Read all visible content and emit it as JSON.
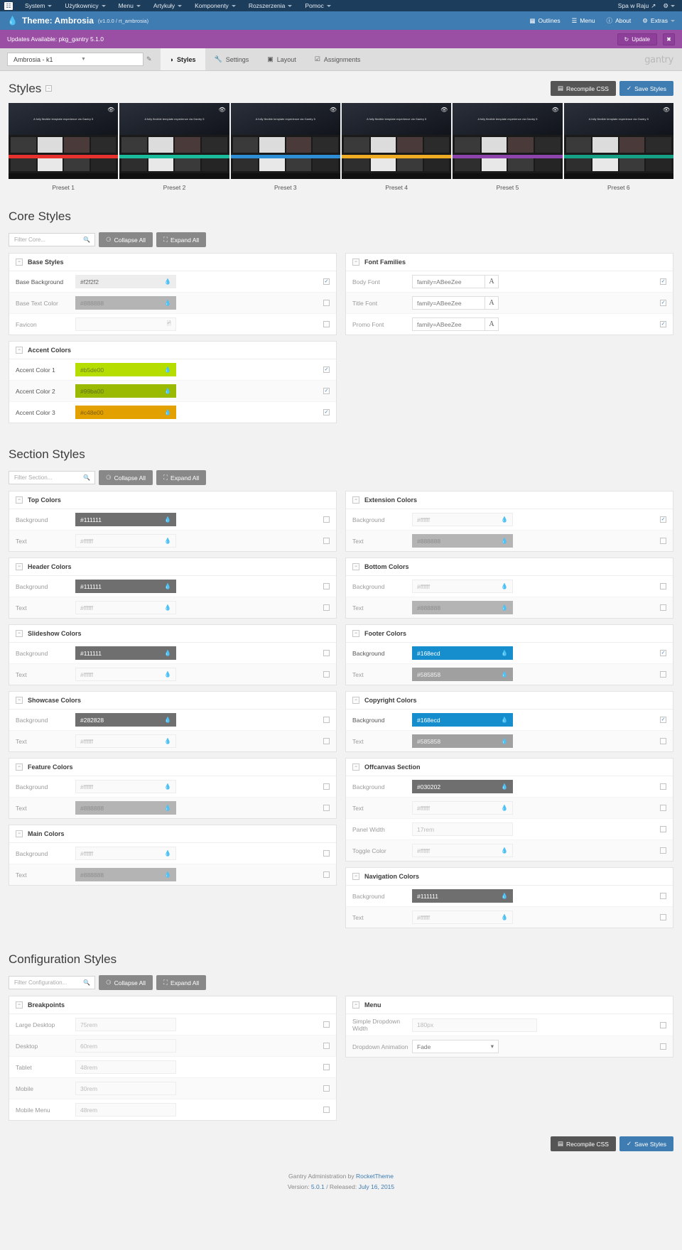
{
  "joomla_bar": {
    "logo_icon": "joomla-logo-icon",
    "menu": [
      "System",
      "Użytkownicy",
      "Menu",
      "Artykuły",
      "Komponenty",
      "Rozszerzenia",
      "Pomoc"
    ],
    "site_name": "Spa w Raju",
    "gear_icon": "gear-icon"
  },
  "gantry_header": {
    "drop_icon": "droplet-icon",
    "title": "Theme: Ambrosia",
    "version": "(v1.0.0 / rt_ambrosia)",
    "actions": [
      {
        "label": "Outlines",
        "icon": "grid-icon"
      },
      {
        "label": "Menu",
        "icon": "list-icon"
      },
      {
        "label": "About",
        "icon": "question-icon"
      },
      {
        "label": "Extras",
        "icon": "gear-icon"
      }
    ]
  },
  "update_bar": {
    "message": "Updates Available: pkg_gantry 5.1.0",
    "update_label": "Update",
    "update_icon": "refresh-icon",
    "close_icon": "close-icon"
  },
  "tabbar": {
    "outline_value": "Ambrosia - k1",
    "pencil_icon": "pencil-icon",
    "tabs": [
      {
        "label": "Styles",
        "icon": "contrast-icon",
        "active": true
      },
      {
        "label": "Settings",
        "icon": "wrench-icon",
        "active": false
      },
      {
        "label": "Layout",
        "icon": "layout-icon",
        "active": false
      },
      {
        "label": "Assignments",
        "icon": "check-square-icon",
        "active": false
      }
    ],
    "brand": "gantry"
  },
  "styles_header": {
    "title": "Styles",
    "recompile_label": "Recompile CSS",
    "recompile_icon": "css-icon",
    "save_label": "Save Styles",
    "save_icon": "check-icon"
  },
  "presets": [
    {
      "label": "Preset 1",
      "accent": "#e8322e",
      "eye_icon": "eye-icon"
    },
    {
      "label": "Preset 2",
      "accent": "#1abc9c",
      "eye_icon": "eye-icon"
    },
    {
      "label": "Preset 3",
      "accent": "#2f8fd6",
      "eye_icon": "eye-icon"
    },
    {
      "label": "Preset 4",
      "accent": "#f0ad24",
      "eye_icon": "eye-icon"
    },
    {
      "label": "Preset 5",
      "accent": "#8e44ad",
      "eye_icon": "eye-icon"
    },
    {
      "label": "Preset 6",
      "accent": "#16a085",
      "eye_icon": "eye-icon"
    }
  ],
  "preset_thumb_text": "A fully flexible template experience via Gantry 5",
  "core": {
    "title": "Core Styles",
    "filter_placeholder": "Filter Core...",
    "collapse_label": "Collapse All",
    "expand_label": "Expand All",
    "panels_left": [
      {
        "title": "Base Styles",
        "fields": [
          {
            "label": "Base Background",
            "value": "#f2f2f2",
            "type": "color",
            "bg": "#ededed",
            "fg": "#666",
            "disabled": false,
            "override": true
          },
          {
            "label": "Base Text Color",
            "value": "#888888",
            "type": "color",
            "bg": "#b4b4b4",
            "fg": "#8d8d8d",
            "disabled": true,
            "override": false
          },
          {
            "label": "Favicon",
            "value": "",
            "type": "file",
            "disabled": true,
            "override": false
          }
        ]
      },
      {
        "title": "Accent Colors",
        "fields": [
          {
            "label": "Accent Color 1",
            "value": "#b5de00",
            "type": "color",
            "bg": "#b5de00",
            "fg": "#6b7d22",
            "disabled": false,
            "override": true
          },
          {
            "label": "Accent Color 2",
            "value": "#99ba00",
            "type": "color",
            "bg": "#99ba00",
            "fg": "#5d7017",
            "disabled": false,
            "override": true
          },
          {
            "label": "Accent Color 3",
            "value": "#c48e00",
            "type": "color",
            "bg": "#e2a100",
            "fg": "#7d5d0b",
            "disabled": false,
            "override": true
          }
        ]
      }
    ],
    "panels_right": [
      {
        "title": "Font Families",
        "fields": [
          {
            "label": "Body Font",
            "value": "family=ABeeZee",
            "type": "font",
            "btn": "A",
            "override": true
          },
          {
            "label": "Title Font",
            "value": "family=ABeeZee",
            "type": "font",
            "btn": "A",
            "override": true
          },
          {
            "label": "Promo Font",
            "value": "family=ABeeZee",
            "type": "font",
            "btn": "A",
            "override": true
          }
        ]
      }
    ]
  },
  "section": {
    "title": "Section Styles",
    "filter_placeholder": "Filter Section...",
    "collapse_label": "Collapse All",
    "expand_label": "Expand All",
    "panels_left": [
      {
        "title": "Top Colors",
        "fields": [
          {
            "label": "Background",
            "value": "#111111",
            "type": "color",
            "bg": "#6f6f6f",
            "fg": "#ffffff",
            "disabled": true,
            "override": false
          },
          {
            "label": "Text",
            "value": "#ffffff",
            "type": "color",
            "bg": "#fafafa",
            "fg": "#b9b9b9",
            "disabled": true,
            "override": false
          }
        ]
      },
      {
        "title": "Header Colors",
        "fields": [
          {
            "label": "Background",
            "value": "#111111",
            "type": "color",
            "bg": "#6f6f6f",
            "fg": "#ffffff",
            "disabled": true,
            "override": false
          },
          {
            "label": "Text",
            "value": "#ffffff",
            "type": "color",
            "bg": "#fafafa",
            "fg": "#b9b9b9",
            "disabled": true,
            "override": false
          }
        ]
      },
      {
        "title": "Slideshow Colors",
        "fields": [
          {
            "label": "Background",
            "value": "#111111",
            "type": "color",
            "bg": "#6f6f6f",
            "fg": "#ffffff",
            "disabled": true,
            "override": false
          },
          {
            "label": "Text",
            "value": "#ffffff",
            "type": "color",
            "bg": "#fafafa",
            "fg": "#b9b9b9",
            "disabled": true,
            "override": false
          }
        ]
      },
      {
        "title": "Showcase Colors",
        "fields": [
          {
            "label": "Background",
            "value": "#282828",
            "type": "color",
            "bg": "#6f6f6f",
            "fg": "#ffffff",
            "disabled": true,
            "override": false
          },
          {
            "label": "Text",
            "value": "#ffffff",
            "type": "color",
            "bg": "#fafafa",
            "fg": "#b9b9b9",
            "disabled": true,
            "override": false
          }
        ]
      },
      {
        "title": "Feature Colors",
        "fields": [
          {
            "label": "Background",
            "value": "#ffffff",
            "type": "color",
            "bg": "#fafafa",
            "fg": "#b9b9b9",
            "disabled": true,
            "override": false
          },
          {
            "label": "Text",
            "value": "#888888",
            "type": "color",
            "bg": "#b4b4b4",
            "fg": "#8d8d8d",
            "disabled": true,
            "override": false
          }
        ]
      },
      {
        "title": "Main Colors",
        "fields": [
          {
            "label": "Background",
            "value": "#ffffff",
            "type": "color",
            "bg": "#fafafa",
            "fg": "#b9b9b9",
            "disabled": true,
            "override": false
          },
          {
            "label": "Text",
            "value": "#888888",
            "type": "color",
            "bg": "#b4b4b4",
            "fg": "#8d8d8d",
            "disabled": true,
            "override": false
          }
        ]
      }
    ],
    "panels_right": [
      {
        "title": "Extension Colors",
        "fields": [
          {
            "label": "Background",
            "value": "#ffffff",
            "type": "color",
            "bg": "#fcfcfc",
            "fg": "#b9b9b9",
            "disabled": true,
            "override": true
          },
          {
            "label": "Text",
            "value": "#888888",
            "type": "color",
            "bg": "#b4b4b4",
            "fg": "#8d8d8d",
            "disabled": true,
            "override": false
          }
        ]
      },
      {
        "title": "Bottom Colors",
        "fields": [
          {
            "label": "Background",
            "value": "#ffffff",
            "type": "color",
            "bg": "#fafafa",
            "fg": "#b9b9b9",
            "disabled": true,
            "override": false
          },
          {
            "label": "Text",
            "value": "#888888",
            "type": "color",
            "bg": "#b4b4b4",
            "fg": "#8d8d8d",
            "disabled": true,
            "override": false
          }
        ]
      },
      {
        "title": "Footer Colors",
        "fields": [
          {
            "label": "Background",
            "value": "#168ecd",
            "type": "color",
            "bg": "#168ecd",
            "fg": "#ffffff",
            "disabled": false,
            "override": true
          },
          {
            "label": "Text",
            "value": "#585858",
            "type": "color",
            "bg": "#a0a0a0",
            "fg": "#efefef",
            "disabled": true,
            "override": false
          }
        ]
      },
      {
        "title": "Copyright Colors",
        "fields": [
          {
            "label": "Background",
            "value": "#168ecd",
            "type": "color",
            "bg": "#168ecd",
            "fg": "#ffffff",
            "disabled": false,
            "override": true
          },
          {
            "label": "Text",
            "value": "#585858",
            "type": "color",
            "bg": "#a0a0a0",
            "fg": "#efefef",
            "disabled": true,
            "override": false
          }
        ]
      },
      {
        "title": "Offcanvas Section",
        "fields": [
          {
            "label": "Background",
            "value": "#030202",
            "type": "color",
            "bg": "#6f6f6f",
            "fg": "#ffffff",
            "disabled": true,
            "override": false
          },
          {
            "label": "Text",
            "value": "#ffffff",
            "type": "color",
            "bg": "#fafafa",
            "fg": "#b9b9b9",
            "disabled": true,
            "override": false
          },
          {
            "label": "Panel Width",
            "value": "17rem",
            "type": "text",
            "disabled": true,
            "override": false
          },
          {
            "label": "Toggle Color",
            "value": "#ffffff",
            "type": "color",
            "bg": "#fafafa",
            "fg": "#b9b9b9",
            "disabled": true,
            "override": false
          }
        ]
      },
      {
        "title": "Navigation Colors",
        "fields": [
          {
            "label": "Background",
            "value": "#111111",
            "type": "color",
            "bg": "#6f6f6f",
            "fg": "#ffffff",
            "disabled": true,
            "override": false
          },
          {
            "label": "Text",
            "value": "#ffffff",
            "type": "color",
            "bg": "#fafafa",
            "fg": "#b9b9b9",
            "disabled": true,
            "override": false
          }
        ]
      }
    ]
  },
  "configuration": {
    "title": "Configuration Styles",
    "filter_placeholder": "Filter Configuration...",
    "collapse_label": "Collapse All",
    "expand_label": "Expand All",
    "panels_left": [
      {
        "title": "Breakpoints",
        "fields": [
          {
            "label": "Large Desktop",
            "value": "75rem",
            "type": "text",
            "disabled": true,
            "override": false
          },
          {
            "label": "Desktop",
            "value": "60rem",
            "type": "text",
            "disabled": true,
            "override": false
          },
          {
            "label": "Tablet",
            "value": "48rem",
            "type": "text",
            "disabled": true,
            "override": false
          },
          {
            "label": "Mobile",
            "value": "30rem",
            "type": "text",
            "disabled": true,
            "override": false
          },
          {
            "label": "Mobile Menu",
            "value": "48rem",
            "type": "text",
            "disabled": true,
            "override": false
          }
        ]
      }
    ],
    "panels_right": [
      {
        "title": "Menu",
        "fields": [
          {
            "label": "Simple Dropdown Width",
            "value": "180px",
            "type": "text",
            "disabled": true,
            "override": false
          },
          {
            "label": "Dropdown Animation",
            "value": "Fade",
            "type": "select",
            "disabled": true,
            "override": false
          }
        ]
      }
    ]
  },
  "credits": {
    "line1_pre": "Gantry Administration by ",
    "line1_link": "RocketTheme",
    "version_pre": "Version: ",
    "version": "5.0.1",
    "released_pre": " / Released: ",
    "released": "July 16, 2015"
  }
}
